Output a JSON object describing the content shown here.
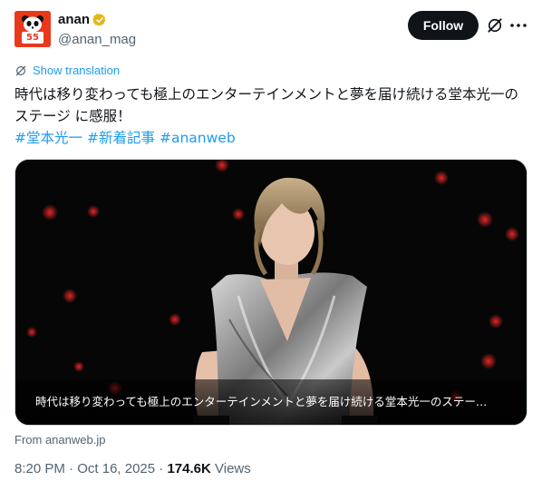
{
  "author": {
    "name": "anan",
    "handle": "@anan_mag",
    "avatar_text": "55",
    "avatar_color": "#e8391d",
    "verified_badge_color": "#e2b719"
  },
  "actions": {
    "follow_label": "Follow",
    "grok_icon": "grok-icon",
    "more_icon": "more-icon"
  },
  "translation": {
    "label": "Show translation"
  },
  "tweet": {
    "text": "時代は移り変わっても極上のエンターテインメントと夢を届け続ける堂本光一のステージ に感服！",
    "hashtags": [
      "#堂本光一",
      "#新着記事",
      "#ananweb"
    ]
  },
  "media": {
    "caption": "時代は移り変わっても極上のエンターテインメントと夢を届け続ける堂本光一のステー…",
    "source": "From ananweb.jp"
  },
  "meta": {
    "time": "8:20 PM",
    "date": "Oct 16, 2025",
    "separator": "·",
    "views_count": "174.6K",
    "views_label": "Views"
  },
  "colors": {
    "link": "#1d9bf0",
    "text": "#0f1419",
    "secondary": "#536471"
  }
}
